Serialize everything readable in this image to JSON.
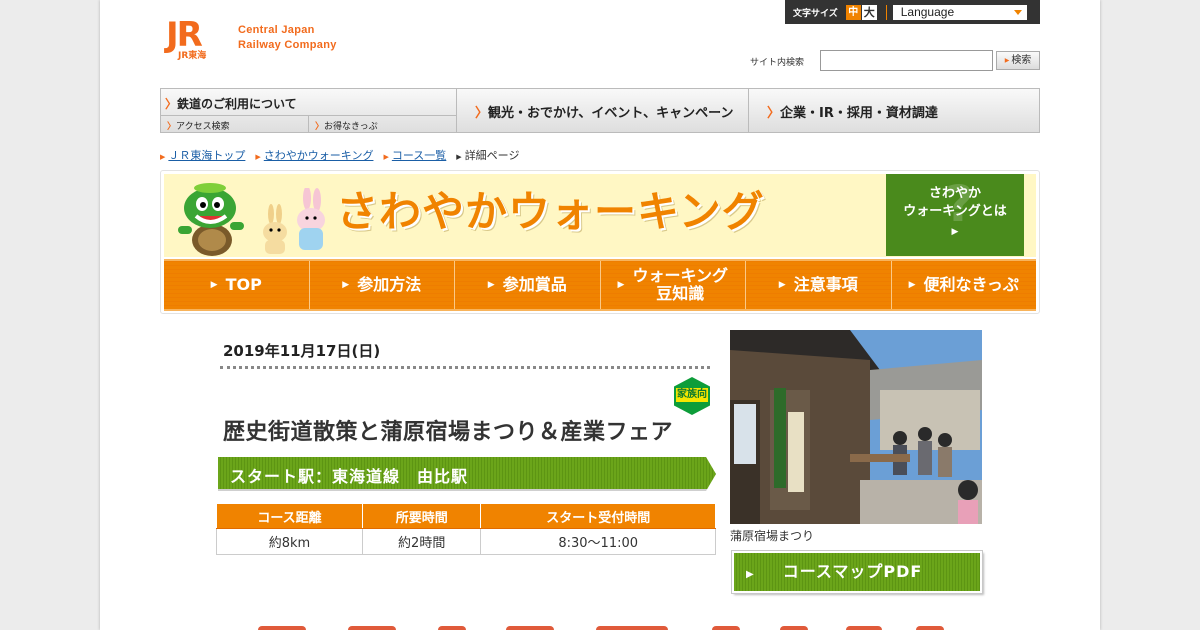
{
  "header": {
    "logo_mark": "JR",
    "logo_sub": "JR東海",
    "logo_line1": "Central Japan",
    "logo_line2": "Railway Company",
    "font_size_label": "文字サイズ",
    "font_mid": "中",
    "font_big": "大",
    "language_label": "Language",
    "search_label": "サイト内検索",
    "search_value": "",
    "search_button": "検索"
  },
  "global_nav": {
    "rail": "鉄道のご利用について",
    "access": "アクセス検索",
    "tickets": "お得なきっぷ",
    "tourism": "観光・おでかけ、イベント、キャンペーン",
    "corporate": "企業・IR・採用・資材調達"
  },
  "breadcrumb": [
    "ＪＲ東海トップ",
    "さわやかウォーキング",
    "コース一覧",
    "詳細ページ"
  ],
  "banner": {
    "title": "さわやかウォーキング",
    "about_line1": "さわやか",
    "about_line2": "ウォーキングとは",
    "nav": [
      "TOP",
      "参加方法",
      "参加賞品",
      "ウォーキング\n豆知識",
      "注意事項",
      "便利なきっぷ"
    ]
  },
  "event": {
    "date": "2019年11月17日(日)",
    "badge": "家族向",
    "title": "歴史街道散策と蒲原宿場まつり＆産業フェア",
    "start_station": "スタート駅：東海道線　由比駅",
    "table_headers": [
      "コース距離",
      "所要時間",
      "スタート受付時間"
    ],
    "table_values": [
      "約8km",
      "約2時間",
      "8:30～11:00"
    ],
    "photo_caption": "蒲原宿場まつり",
    "pdf_button": "コースマップPDF"
  },
  "colors": {
    "orange": "#f08300",
    "jr_orange": "#f26b1d",
    "green": "#5d9513",
    "link": "#1a5ea6"
  }
}
